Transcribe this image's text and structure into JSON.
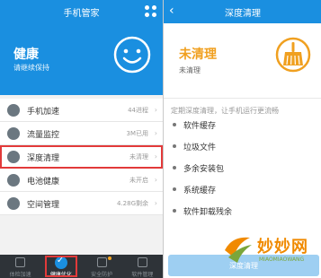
{
  "left": {
    "title": "手机管家",
    "hero": {
      "title": "健康",
      "subtitle": "请继续保持"
    },
    "items": [
      {
        "label": "手机加速",
        "value": "44进程",
        "icon": "rocket-icon"
      },
      {
        "label": "流量监控",
        "value": "3M已用",
        "icon": "chart-icon"
      },
      {
        "label": "深度清理",
        "value": "未清理",
        "icon": "clean-icon",
        "highlight": true
      },
      {
        "label": "电池健康",
        "value": "未开启",
        "icon": "battery-icon"
      },
      {
        "label": "空间管理",
        "value": "4.28G剩余",
        "icon": "storage-icon"
      }
    ],
    "nav": [
      {
        "label": "体检加速"
      },
      {
        "label": "健康优化"
      },
      {
        "label": "安全防护"
      },
      {
        "label": "软件管理"
      }
    ]
  },
  "right": {
    "title": "深度清理",
    "status": {
      "title": "未清理",
      "subtitle": "未清理"
    },
    "hint": "定期深度清理，让手机运行更流畅",
    "items": [
      "软件缓存",
      "垃圾文件",
      "多余安装包",
      "系统缓存",
      "软件卸载残余"
    ],
    "cta": "深度清理"
  },
  "watermark": {
    "title": "妙妙网",
    "subtitle": "MIAOMIAOWANG"
  },
  "colors": {
    "brand_blue": "#1a8fe0",
    "warning_orange": "#f0a020",
    "highlight_red": "#e23a3a"
  }
}
